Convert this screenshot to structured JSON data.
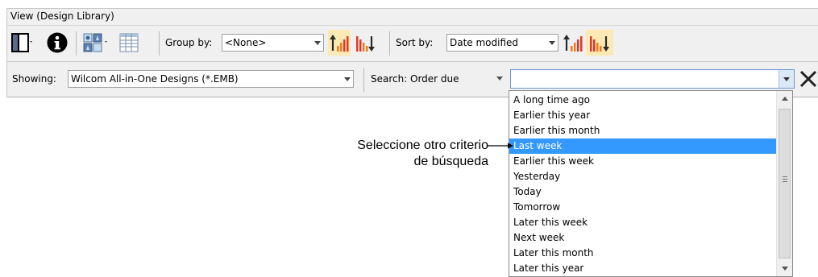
{
  "panel": {
    "title": "View (Design Library)"
  },
  "toolbar1": {
    "group_by_label": "Group by:",
    "group_by_value": "<None>",
    "sort_by_label": "Sort by:",
    "sort_by_value": "Date modified"
  },
  "toolbar2": {
    "showing_label": "Showing:",
    "showing_value": "Wilcom All-in-One Designs (*.EMB)",
    "search_label": "Search:",
    "search_criteria_value": "Order due",
    "search_text_value": ""
  },
  "dropdown": {
    "items": [
      "A long time ago",
      "Earlier this year",
      "Earlier this month",
      "Last week",
      "Earlier this week",
      "Yesterday",
      "Today",
      "Tomorrow",
      "Later this week",
      "Next week",
      "Later this month",
      "Later this year"
    ],
    "selected_index": 3
  },
  "callout": {
    "line1": "Seleccione otro criterio",
    "line2": "de búsqueda"
  },
  "icons": {
    "ascending_sort": "sort-ascending-icon",
    "descending_sort": "sort-descending-icon",
    "info": "info-icon",
    "thumbnails": "thumbnail-view-icon",
    "details": "details-view-icon",
    "pane": "pane-layout-icon",
    "clear": "close-icon"
  },
  "colors": {
    "selection": "#3399ff",
    "sort_highlight": "#fde9b4",
    "bar_orange": "#f07c1a",
    "bar_red": "#e0382a"
  }
}
